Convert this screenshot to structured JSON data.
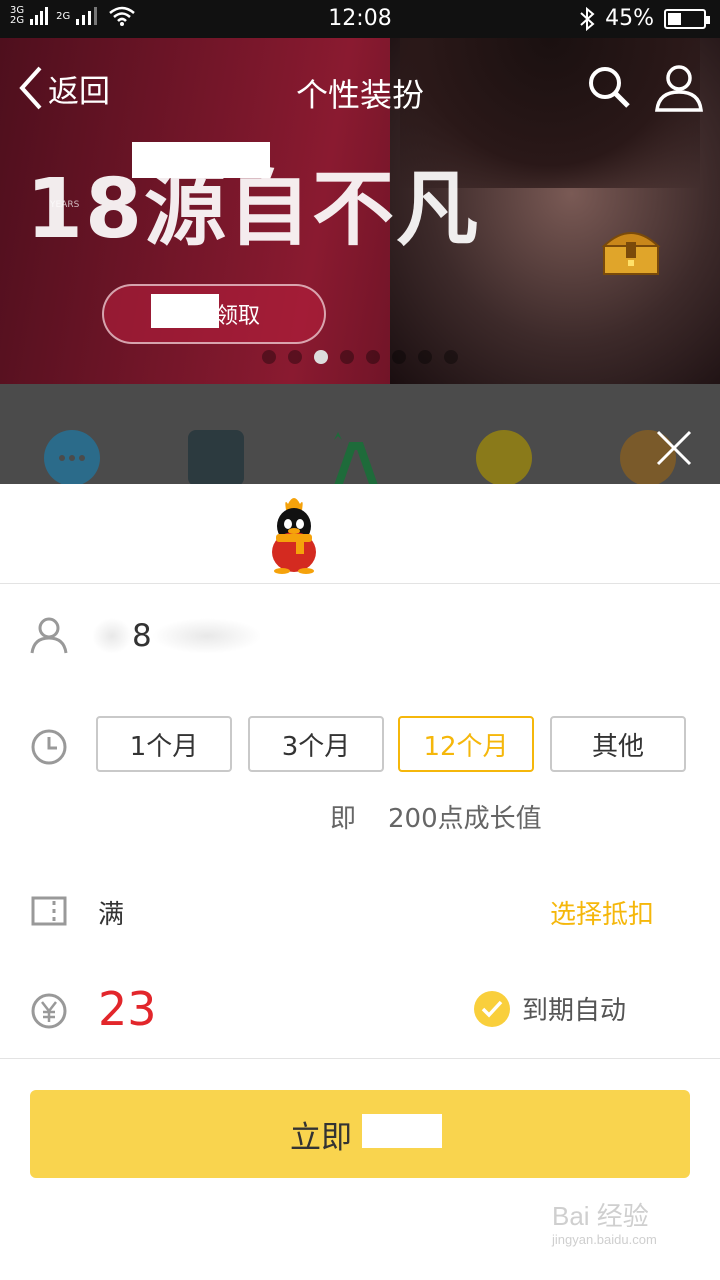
{
  "status_bar": {
    "network_1": "3G",
    "network_2": "2G",
    "network_3": "2G",
    "time": "12:08",
    "battery_percent": "45%",
    "battery_level": 0.45
  },
  "header": {
    "back_label": "返回",
    "title": "个性装扮"
  },
  "banner": {
    "slogan": "源自不凡",
    "number": "18",
    "years_label": "YEARS",
    "button_label": "领取",
    "slide_count": 8,
    "active_slide": 2
  },
  "purchase": {
    "account_text": "8",
    "durations": [
      "1个月",
      "3个月",
      "12个月",
      "其他"
    ],
    "selected_duration_index": 2,
    "growth_prefix": "即",
    "growth_value": "200点成长值",
    "coupon_label": "满",
    "coupon_action": "选择抵扣",
    "price": "23",
    "auto_renew_label": "到期自动",
    "pay_button_label": "立即"
  },
  "watermark": {
    "brand": "Bai 经验",
    "url": "jingyan.baidu.com"
  },
  "colors": {
    "accent": "#f5b70b",
    "pay_button": "#f9d44e",
    "price": "#e2262b"
  }
}
